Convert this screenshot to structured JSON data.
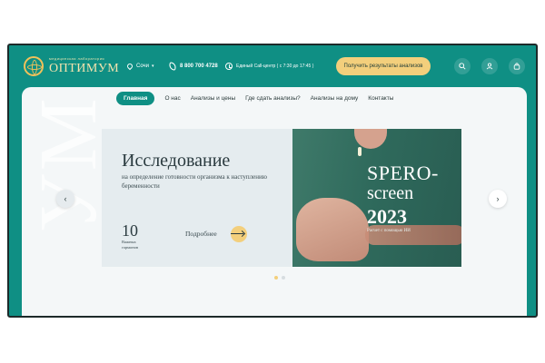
{
  "header": {
    "logo_subtitle": "медицинская лаборатория",
    "logo_name": "ОПТИМУМ",
    "city": "Сочи",
    "phone": "8 800 700 4728",
    "callcenter": "Единый Call-центр ( с 7:30 до 17:45 )",
    "results_button": "Получить результаты анализов",
    "icons": [
      "search-icon",
      "user-icon",
      "cart-icon"
    ]
  },
  "nav": {
    "items": [
      {
        "label": "Главная",
        "active": true
      },
      {
        "label": "О нас"
      },
      {
        "label": "Анализы и цены"
      },
      {
        "label": "Где сдать анализы?"
      },
      {
        "label": "Анализы на дому"
      },
      {
        "label": "Контакты"
      }
    ]
  },
  "banner": {
    "title": "Исследование",
    "description": "на определение готовности организма к наступлению беременности",
    "days_number": "10",
    "days_label": "Важных гормонов",
    "more_link": "Подробнее",
    "spero_line1": "SPERO-",
    "spero_line2": "screen",
    "spero_line3": "2023",
    "spero_note": "Расчет с помощью ИИ"
  },
  "slider": {
    "total_slides": 2,
    "current_slide": 1
  },
  "colors": {
    "brand_teal": "#0f8f84",
    "accent_yellow": "#f3cf7c",
    "panel_bg": "#f4f7f8"
  }
}
